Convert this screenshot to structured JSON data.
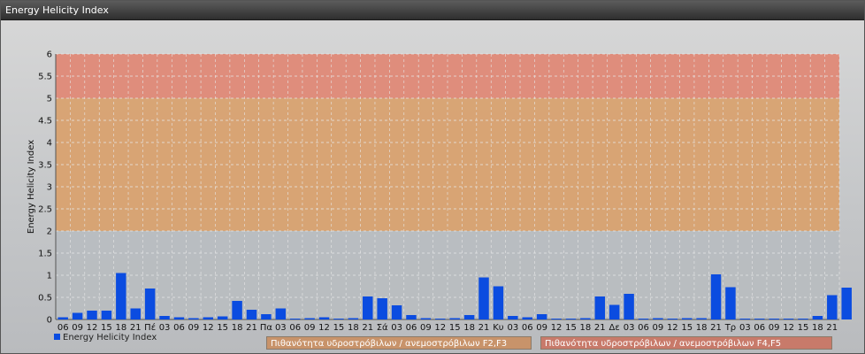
{
  "window": {
    "title": "Energy Helicity Index"
  },
  "colors": {
    "bar": "#0b4ce0",
    "band_low": "#b8bcc0",
    "band_mid": "#d9a06a",
    "band_high": "#e08572",
    "grid": "#e8e8e8"
  },
  "legend": {
    "series": "Energy Helicity Index",
    "band1": "Πιθανότητα υδροστρόβιλων / ανεμοστρόβιλων F2,F3",
    "band2": "Πιθανότητα υδροστρόβιλων / ανεμοστρόβιλων F4,F5"
  },
  "chart_data": {
    "type": "bar",
    "title": "",
    "xlabel": "",
    "ylabel": "Energy Helicity Index",
    "ylim": [
      0,
      6
    ],
    "yticks": [
      "0",
      "0.5",
      "1",
      "1.5",
      "2",
      "2.5",
      "3",
      "3.5",
      "4",
      "4.5",
      "5",
      "5.5",
      "6"
    ],
    "bands": [
      {
        "from": 0,
        "to": 2,
        "color": "#b8bcc0"
      },
      {
        "from": 2,
        "to": 5,
        "color": "#d9a06a"
      },
      {
        "from": 5,
        "to": 6,
        "color": "#e08572"
      }
    ],
    "categories": [
      "06",
      "09",
      "12",
      "15",
      "18",
      "21",
      "Πέ",
      "03",
      "06",
      "09",
      "12",
      "15",
      "18",
      "21",
      "Πα",
      "03",
      "06",
      "09",
      "12",
      "15",
      "18",
      "21",
      "Σά",
      "03",
      "06",
      "09",
      "12",
      "15",
      "18",
      "21",
      "Κυ",
      "03",
      "06",
      "09",
      "12",
      "15",
      "18",
      "21",
      "Δε",
      "03",
      "06",
      "09",
      "12",
      "15",
      "18",
      "21",
      "Τρ",
      "03",
      "06",
      "09",
      "12",
      "15",
      "18",
      "21"
    ],
    "series": [
      {
        "name": "Energy Helicity Index",
        "values": [
          0.05,
          0.15,
          0.2,
          0.2,
          1.05,
          0.25,
          0.7,
          0.08,
          0.05,
          0.03,
          0.05,
          0.07,
          0.42,
          0.22,
          0.12,
          0.25,
          0.02,
          0.03,
          0.05,
          0.02,
          0.03,
          0.52,
          0.48,
          0.32,
          0.1,
          0.03,
          0.02,
          0.03,
          0.1,
          0.95,
          0.75,
          0.08,
          0.05,
          0.12,
          0.02,
          0.02,
          0.03,
          0.52,
          0.33,
          0.58,
          0.02,
          0.03,
          0.02,
          0.03,
          0.03,
          1.02,
          0.73,
          0.02,
          0.02,
          0.02,
          0.02,
          0.02,
          0.08,
          0.55,
          0.72
        ]
      }
    ]
  }
}
